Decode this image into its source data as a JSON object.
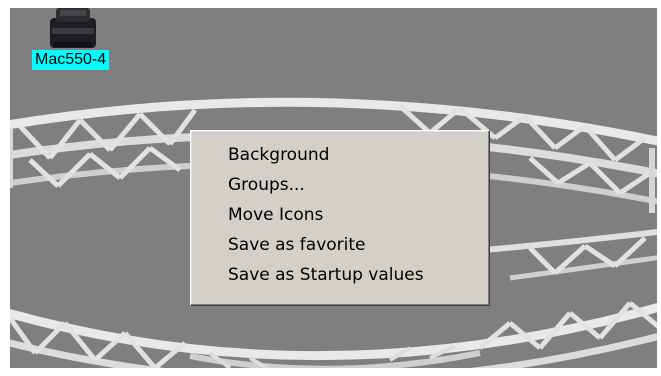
{
  "fixture": {
    "label": "Mac550-4",
    "icon": "moving-head-fixture-icon",
    "label_bg_color": "#00ffff"
  },
  "background": {
    "color": "#7f7f7f",
    "image": "circular-truss"
  },
  "context_menu": {
    "items": [
      {
        "label": "Background"
      },
      {
        "label": "Groups..."
      },
      {
        "label": "Move Icons"
      },
      {
        "label": "Save as favorite"
      },
      {
        "label": "Save as Startup values"
      }
    ],
    "bg_color": "#d4d0c8"
  }
}
